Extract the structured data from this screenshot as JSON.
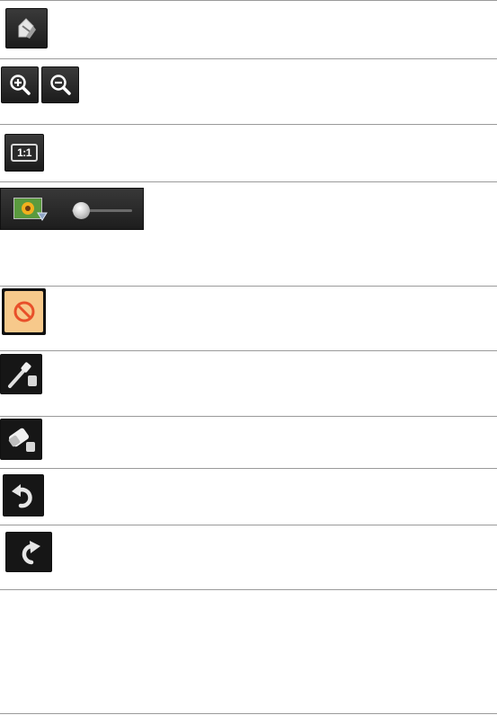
{
  "toolbar": {
    "ratio_label": "1:1"
  },
  "icons": [
    "eraser-pen-icon",
    "zoom-in-icon",
    "zoom-out-icon",
    "actual-size-icon",
    "thumbnail-size-icon",
    "not-allowed-icon",
    "eyedropper-icon",
    "eraser-icon",
    "undo-icon",
    "redo-icon"
  ],
  "thumbnail_slider": {
    "level": 0.15
  },
  "colors": {
    "button_dark": "#1c1c1c",
    "not_allowed_bg": "#f7c98b",
    "not_allowed_symbol": "#e8502a",
    "rule": "#9a9a9a"
  }
}
